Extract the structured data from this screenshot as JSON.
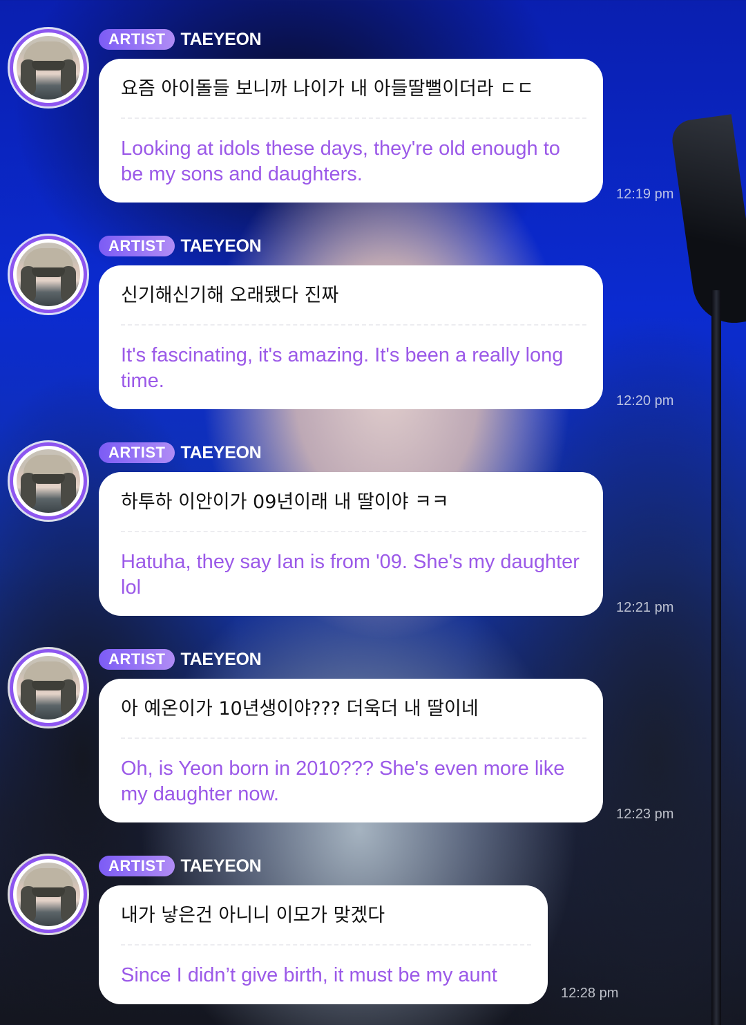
{
  "messages": [
    {
      "badge": "ARTIST",
      "author": "TAEYEON",
      "korean": "요즘 아이돌들 보니까 나이가 내 아들딸뻘이더라 ㄷㄷ",
      "english": "Looking at idols these days, they're old enough to be my sons and daughters.",
      "time": "12:19 pm"
    },
    {
      "badge": "ARTIST",
      "author": "TAEYEON",
      "korean": "신기해신기해 오래됐다 진짜",
      "english": "It's fascinating, it's amazing. It's been a really long time.",
      "time": "12:20 pm"
    },
    {
      "badge": "ARTIST",
      "author": "TAEYEON",
      "korean": "하투하 이안이가 09년이래 내 딸이야 ㅋㅋ",
      "english": "Hatuha, they say Ian is from '09. She's my daughter lol",
      "time": "12:21 pm"
    },
    {
      "badge": "ARTIST",
      "author": "TAEYEON",
      "korean": "아 예온이가 10년생이야??? 더욱더 내 딸이네",
      "english": "Oh, is Yeon born in 2010??? She's even more like my daughter now.",
      "time": "12:23 pm"
    },
    {
      "badge": "ARTIST",
      "author": "TAEYEON",
      "korean": "내가 낳은건 아니니 이모가 맞겠다",
      "english": "Since I didn’t give birth, it must be my aunt",
      "time": "12:28 pm"
    }
  ],
  "colors": {
    "accent": "#8d55f0",
    "translation_text": "#9b59e8",
    "badge_start": "#7c5cf5",
    "badge_end": "#b08cf5"
  },
  "icons": {
    "avatar": "profile-photo-avatar"
  }
}
